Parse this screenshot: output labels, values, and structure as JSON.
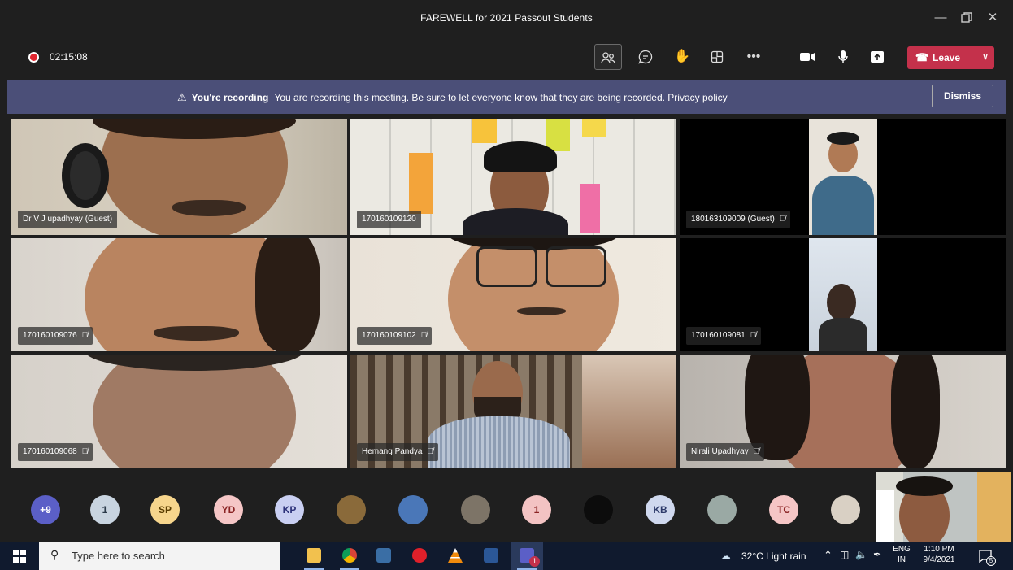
{
  "window": {
    "title": "FAREWELL for 2021 Passout Students",
    "minimize_icon": "minimize-icon",
    "maximize_icon": "maximize-icon",
    "close_icon": "close-icon"
  },
  "toolbar": {
    "timer": "02:15:08",
    "icons": [
      "people-icon",
      "chat-icon",
      "raise-hand-icon",
      "rooms-icon",
      "more-icon",
      "camera-icon",
      "mic-icon",
      "share-icon"
    ],
    "leave_label": "Leave",
    "leave_color": "#c4314b"
  },
  "banner": {
    "bold_text": "You're recording",
    "message": "You are recording this meeting. Be sure to let everyone know that they are being recorded.",
    "link_text": "Privacy policy",
    "dismiss_label": "Dismiss",
    "background": "#4b4f78"
  },
  "tiles": [
    {
      "name": "Dr V J upadhyay (Guest)",
      "muted": false
    },
    {
      "name": "170160109120",
      "muted": false
    },
    {
      "name": "180163109009 (Guest)",
      "muted": true
    },
    {
      "name": "170160109076",
      "muted": true
    },
    {
      "name": "170160109102",
      "muted": true
    },
    {
      "name": "170160109081",
      "muted": true
    },
    {
      "name": "170160109068",
      "muted": true
    },
    {
      "name": "Hemang Pandya",
      "muted": true
    },
    {
      "name": "Nirali Upadhyay",
      "muted": true
    }
  ],
  "participants_strip": [
    {
      "label": "+9",
      "bg": "#5b5fc7",
      "fg": "#ffffff"
    },
    {
      "label": "1",
      "bg": "#c8d4e0",
      "fg": "#2b3a4a"
    },
    {
      "label": "SP",
      "bg": "#f6d58c",
      "fg": "#5a3d00"
    },
    {
      "label": "YD",
      "bg": "#f5c6c6",
      "fg": "#8a2424"
    },
    {
      "label": "KP",
      "bg": "#c9cff2",
      "fg": "#2d327a"
    },
    {
      "label": "",
      "bg": "#8a6a3a",
      "fg": "#ffffff"
    },
    {
      "label": "",
      "bg": "#4a77b8",
      "fg": "#ffffff"
    },
    {
      "label": "",
      "bg": "#7d7467",
      "fg": "#ffffff"
    },
    {
      "label": "1",
      "bg": "#f3c3c3",
      "fg": "#8a2424"
    },
    {
      "label": "",
      "bg": "#0c0c0c",
      "fg": "#ffffff"
    },
    {
      "label": "KB",
      "bg": "#cfd8ee",
      "fg": "#2d3a6a"
    },
    {
      "label": "",
      "bg": "#9aa9a4",
      "fg": "#ffffff"
    },
    {
      "label": "TC",
      "bg": "#f5c6c6",
      "fg": "#8a2424"
    },
    {
      "label": "",
      "bg": "#d9d0c4",
      "fg": "#ffffff"
    }
  ],
  "taskbar": {
    "search_placeholder": "Type here to search",
    "weather": "32°C  Light rain",
    "lang_top": "ENG",
    "lang_bottom": "IN",
    "time": "1:10 PM",
    "date": "9/4/2021",
    "notification_count": "5",
    "teams_badge": "1"
  }
}
